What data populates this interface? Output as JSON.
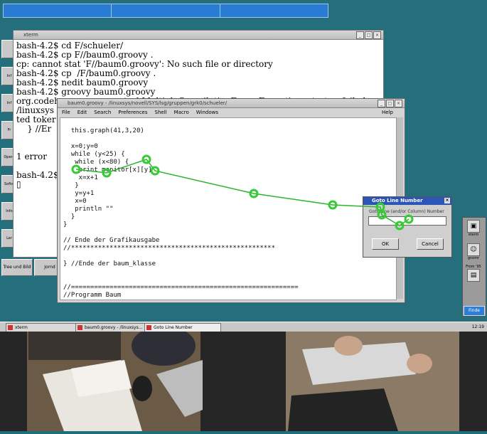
{
  "xterm": {
    "title": "xterm",
    "lines": [
      "bash-4.2$ cd F/schueler/",
      "bash-4.2$ cp F//baum0.groovy .",
      "cp: cannot stat 'F//baum0.groovy': No such file or directory",
      "bash-4.2$ cp  /F/baum0.groovy .",
      "bash-4.2$ nedit baum0.groovy",
      "bash-4.2$ groovy baum0.groovy",
      "org.codehaus.groovy.control.MultipleCompilationErrorsException: startup failed:",
      "/linuxsys",
      "ted toker",
      "    } //Er",
      "",
      "",
      "1 error",
      "",
      "bash-4.2$",
      "▯"
    ]
  },
  "editor": {
    "title": "baum0.groovy - /linuxsys/novell/SYS/lsg/gruppen/grk0/schueler/",
    "menu": [
      "File",
      "Edit",
      "Search",
      "Preferences",
      "Shell",
      "Macro",
      "Windows"
    ],
    "help": "Help",
    "code": "\n  this.graph(41,3,20)\n\n  x=0;y=0\n  while (y<25) {\n   while (x<80) {\n    print monitor[x][y]\n    x=x+1\n   }\n   y=y+1\n   x=0\n   println \"\"\n  }\n}\n\n// Ende der Grafikausgabe\n//*****************************************************\n\n} //Ende der baum_klasse\n\n\n//===========================================================\n//Programm Baum"
  },
  "goto": {
    "title": "Goto Line Number",
    "label": "Goto Line (and/or Column)  Number",
    "ok": "OK",
    "cancel": "Cancel"
  },
  "left_buttons": [
    "",
    "Inf",
    "Inf",
    "Fr",
    "Opera",
    "Softw",
    "Info",
    "Ler"
  ],
  "bottom_buttons": [
    "Tree und Bild",
    "Jornd"
  ],
  "right_panel": [
    {
      "label": "xterm",
      "icon": "terminal-icon"
    },
    {
      "label": "gnomr",
      "icon": "ghost-icon"
    },
    {
      "label": "From '95",
      "icon": "window-icon"
    }
  ],
  "right_panel_button": "Finde",
  "taskbar": {
    "tasks": [
      "xterm",
      "baum0.groovy - /linuxsys...",
      "Goto Line Number"
    ],
    "clock": "12:19"
  }
}
